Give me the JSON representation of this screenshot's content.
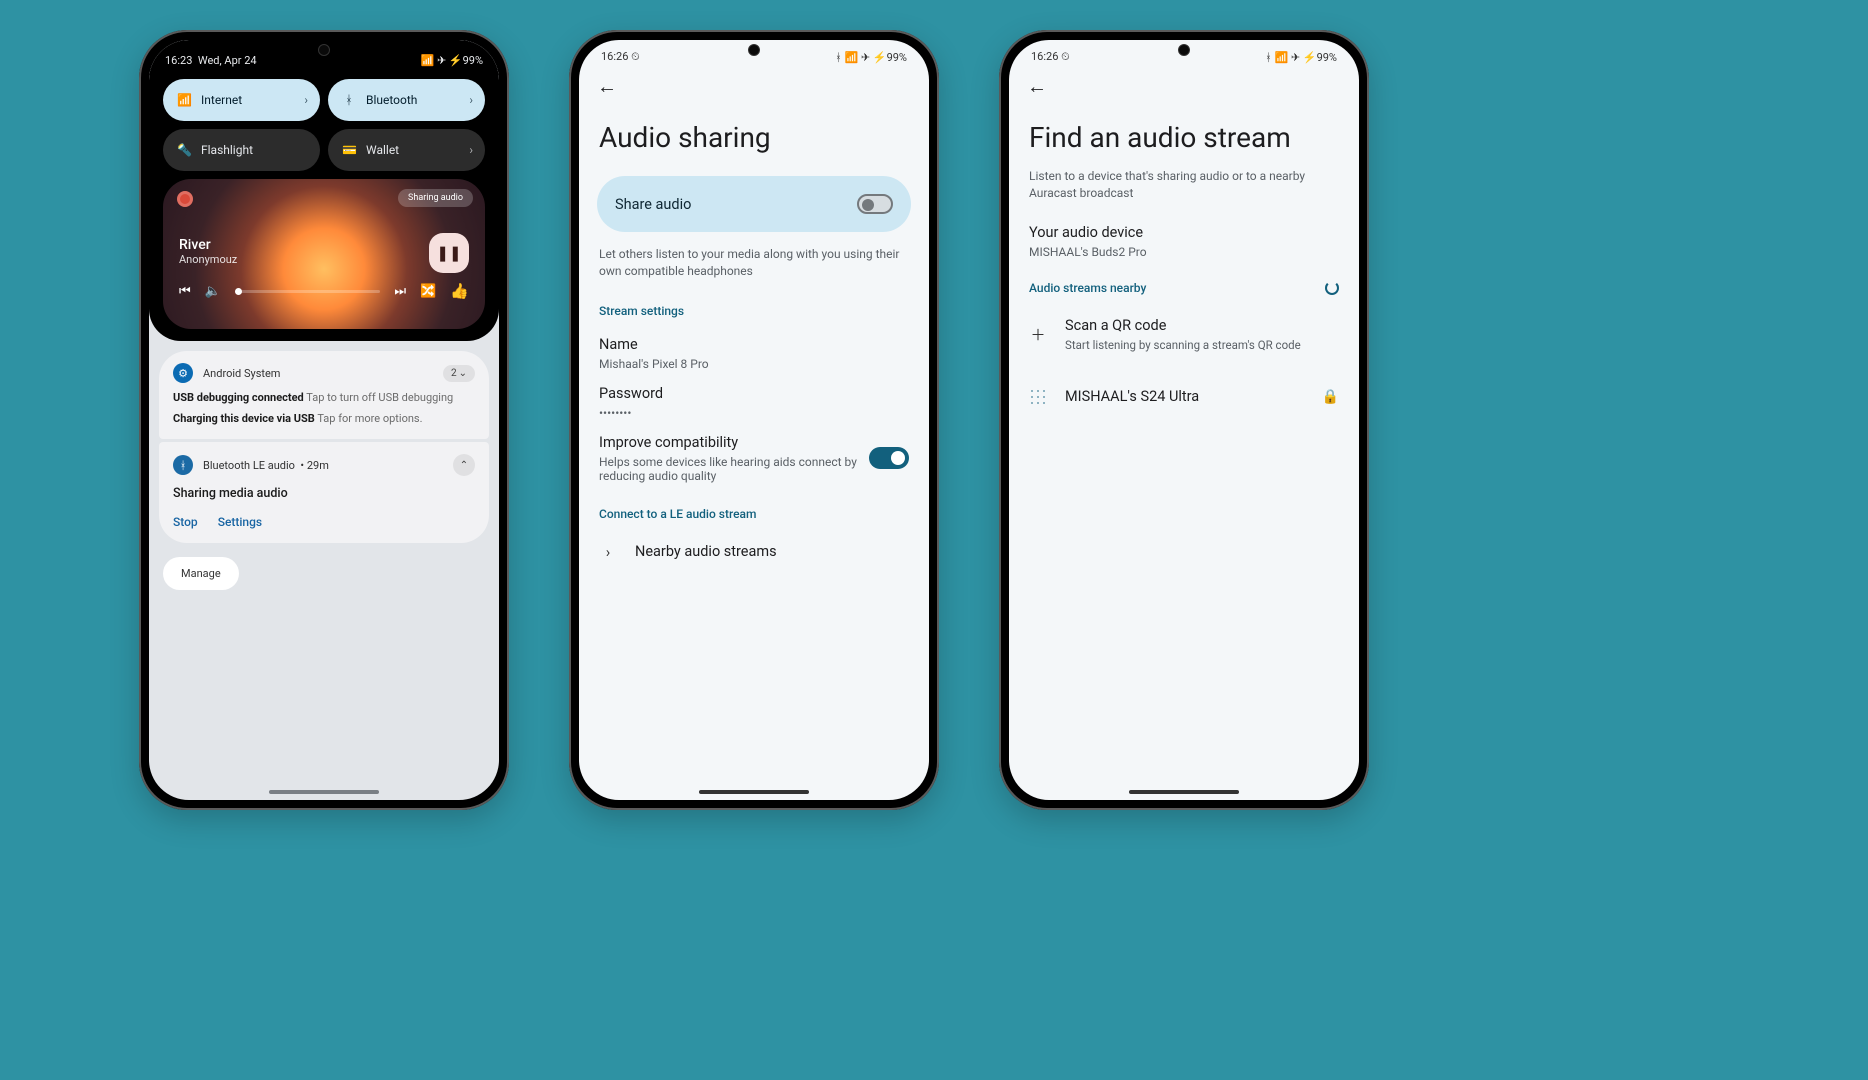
{
  "phone1": {
    "status": {
      "time": "16:23",
      "date": "Wed, Apr 24",
      "right": "✈ ⚡99%"
    },
    "status_icons_left": "📶",
    "qs": [
      {
        "icon": "📶",
        "label": "Internet",
        "active": true,
        "chevron": true
      },
      {
        "icon": "ᚼ",
        "label": "Bluetooth",
        "active": true,
        "chevron": true
      },
      {
        "icon": "🔦",
        "label": "Flashlight",
        "active": false,
        "chevron": false
      },
      {
        "icon": "💳",
        "label": "Wallet",
        "active": false,
        "chevron": true
      }
    ],
    "media": {
      "chip": "Sharing audio",
      "title": "River",
      "artist": "Anonymouz",
      "controls": {
        "prev": "⏮",
        "next": "⏭",
        "shuffle": "🔀",
        "like": "👍"
      }
    },
    "notifs": [
      {
        "app": "Android System",
        "count": "2",
        "lines": [
          {
            "strong": "USB debugging connected",
            "grey": "Tap to turn off USB debugging"
          },
          {
            "strong": "Charging this device via USB",
            "grey": "Tap for more options."
          }
        ]
      },
      {
        "app": "Bluetooth LE audio",
        "time": "29m",
        "title": "Sharing media audio",
        "actions": [
          "Stop",
          "Settings"
        ]
      }
    ],
    "manage": "Manage"
  },
  "phone2": {
    "status": {
      "time": "16:26 ⏲",
      "right": "ᚼ 📶 ✈ ⚡99%"
    },
    "title": "Audio sharing",
    "share_label": "Share audio",
    "desc": "Let others listen to your media along with you using their own compatible headphones",
    "sec_stream": "Stream settings",
    "name": {
      "t": "Name",
      "v": "Mishaal's Pixel 8 Pro"
    },
    "password": {
      "t": "Password",
      "v": "••••••••"
    },
    "compat": {
      "t": "Improve compatibility",
      "v": "Helps some devices like hearing aids connect by reducing audio quality"
    },
    "sec_connect": "Connect to a LE audio stream",
    "nearby": "Nearby audio streams"
  },
  "phone3": {
    "status": {
      "time": "16:26 ⏲",
      "right": "ᚼ 📶 ✈ ⚡99%"
    },
    "title": "Find an audio stream",
    "desc": "Listen to a device that's sharing audio or to a nearby Auracast broadcast",
    "device": {
      "t": "Your audio device",
      "v": "MISHAAL's Buds2 Pro"
    },
    "streams_label": "Audio streams nearby",
    "scan": {
      "t": "Scan a QR code",
      "v": "Start listening by scanning a stream's QR code"
    },
    "found": "MISHAAL's S24 Ultra"
  }
}
